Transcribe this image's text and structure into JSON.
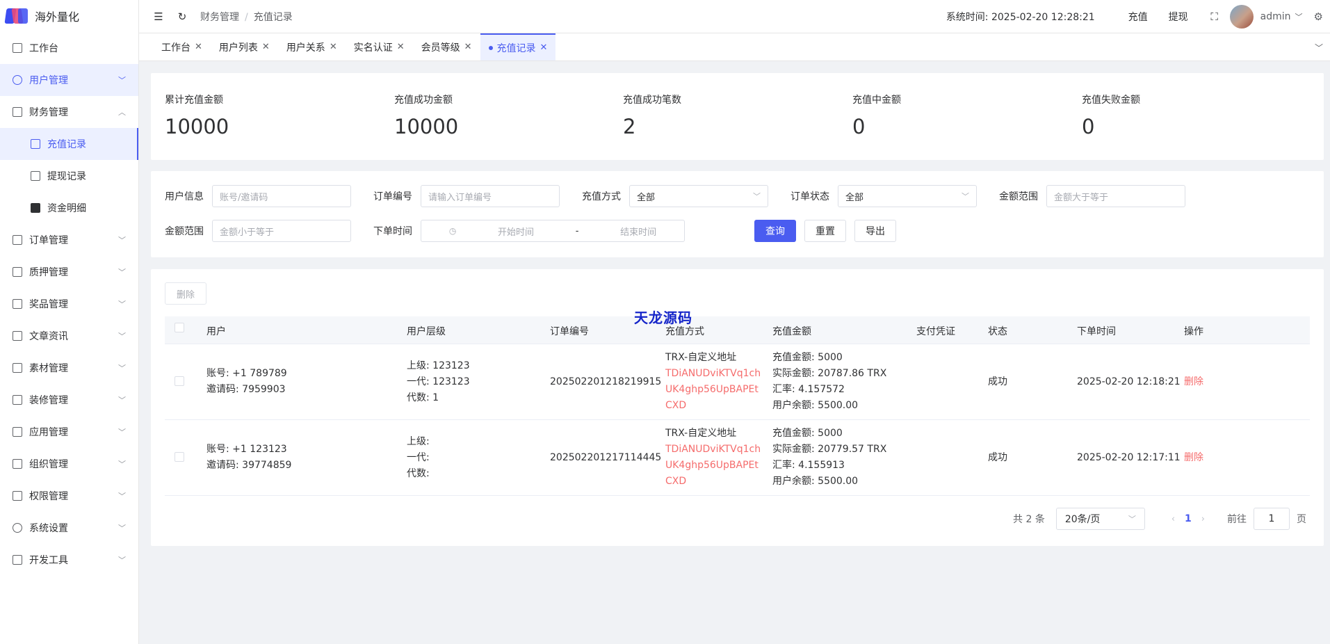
{
  "app": {
    "title": "海外量化"
  },
  "sidebar": {
    "items": [
      {
        "label": "工作台",
        "icon": "monitor-icon"
      },
      {
        "label": "用户管理",
        "icon": "user-icon"
      },
      {
        "label": "财务管理",
        "icon": "chart-icon"
      },
      {
        "label": "充值记录",
        "icon": "folder-icon"
      },
      {
        "label": "提现记录",
        "icon": "folder-icon"
      },
      {
        "label": "资金明细",
        "icon": "wallet-icon"
      },
      {
        "label": "订单管理",
        "icon": "document-icon"
      },
      {
        "label": "质押管理",
        "icon": "copy-icon"
      },
      {
        "label": "奖品管理",
        "icon": "bag-icon"
      },
      {
        "label": "文章资讯",
        "icon": "message-icon"
      },
      {
        "label": "素材管理",
        "icon": "image-icon"
      },
      {
        "label": "装修管理",
        "icon": "tool-icon"
      },
      {
        "label": "应用管理",
        "icon": "app-icon"
      },
      {
        "label": "组织管理",
        "icon": "building-icon"
      },
      {
        "label": "权限管理",
        "icon": "lock-icon"
      },
      {
        "label": "系统设置",
        "icon": "gear-icon"
      },
      {
        "label": "开发工具",
        "icon": "pen-icon"
      }
    ]
  },
  "header": {
    "breadcrumb": [
      "财务管理",
      "充值记录"
    ],
    "system_time": "系统时间: 2025-02-20 12:28:21",
    "recharge": "充值",
    "withdraw": "提现",
    "user": "admin"
  },
  "tabs": [
    "工作台",
    "用户列表",
    "用户关系",
    "实名认证",
    "会员等级",
    "充值记录"
  ],
  "stats": [
    {
      "label": "累计充值金额",
      "value": "10000"
    },
    {
      "label": "充值成功金额",
      "value": "10000"
    },
    {
      "label": "充值成功笔数",
      "value": "2"
    },
    {
      "label": "充值中金额",
      "value": "0"
    },
    {
      "label": "充值失败金额",
      "value": "0"
    }
  ],
  "filters": {
    "user_info_label": "用户信息",
    "user_info_placeholder": "账号/邀请码",
    "order_no_label": "订单编号",
    "order_no_placeholder": "请输入订单编号",
    "method_label": "充值方式",
    "method_value": "全部",
    "status_label": "订单状态",
    "status_value": "全部",
    "amount_label": "金额范围",
    "amount_min_placeholder": "金额大于等于",
    "amount_label2": "金额范围",
    "amount_max_placeholder": "金额小于等于",
    "time_label": "下单时间",
    "start_placeholder": "开始时间",
    "dash": "-",
    "end_placeholder": "结束时间",
    "query": "查询",
    "reset": "重置",
    "export": "导出"
  },
  "table": {
    "delete_button": "删除",
    "watermark": "天龙源码",
    "headers": [
      "用户",
      "用户层级",
      "订单编号",
      "充值方式",
      "充值金额",
      "支付凭证",
      "状态",
      "下单时间",
      "操作"
    ],
    "rows": [
      {
        "account": "账号: +1 789789",
        "invite": "邀请码: 7959903",
        "level_up": "上级: 123123",
        "level_one": "一代: 123123",
        "level_gen": "代数: 1",
        "order_no": "202502201218219915",
        "method": "TRX-自定义地址",
        "addr1": "TDiANUDviKTVq1ch",
        "addr2": "UK4ghp56UpBAPEt",
        "addr3": "CXD",
        "amt": "充值金额: 5000",
        "actual": "实际金额: 20787.86 TRX",
        "rate": "汇率: 4.157572",
        "balance": "用户余额: 5500.00",
        "status": "成功",
        "time": "2025-02-20 12:18:21",
        "op": "删除"
      },
      {
        "account": "账号: +1 123123",
        "invite": "邀请码: 39774859",
        "level_up": "上级:",
        "level_one": "一代:",
        "level_gen": "代数:",
        "order_no": "202502201217114445",
        "method": "TRX-自定义地址",
        "addr1": "TDiANUDviKTVq1ch",
        "addr2": "UK4ghp56UpBAPEt",
        "addr3": "CXD",
        "amt": "充值金额: 5000",
        "actual": "实际金额: 20779.57 TRX",
        "rate": "汇率: 4.155913",
        "balance": "用户余额: 5500.00",
        "status": "成功",
        "time": "2025-02-20 12:17:11",
        "op": "删除"
      }
    ]
  },
  "pagination": {
    "total": "共 2 条",
    "page_size": "20条/页",
    "page": "1",
    "goto_label": "前往",
    "goto_value": "1",
    "page_unit": "页"
  }
}
